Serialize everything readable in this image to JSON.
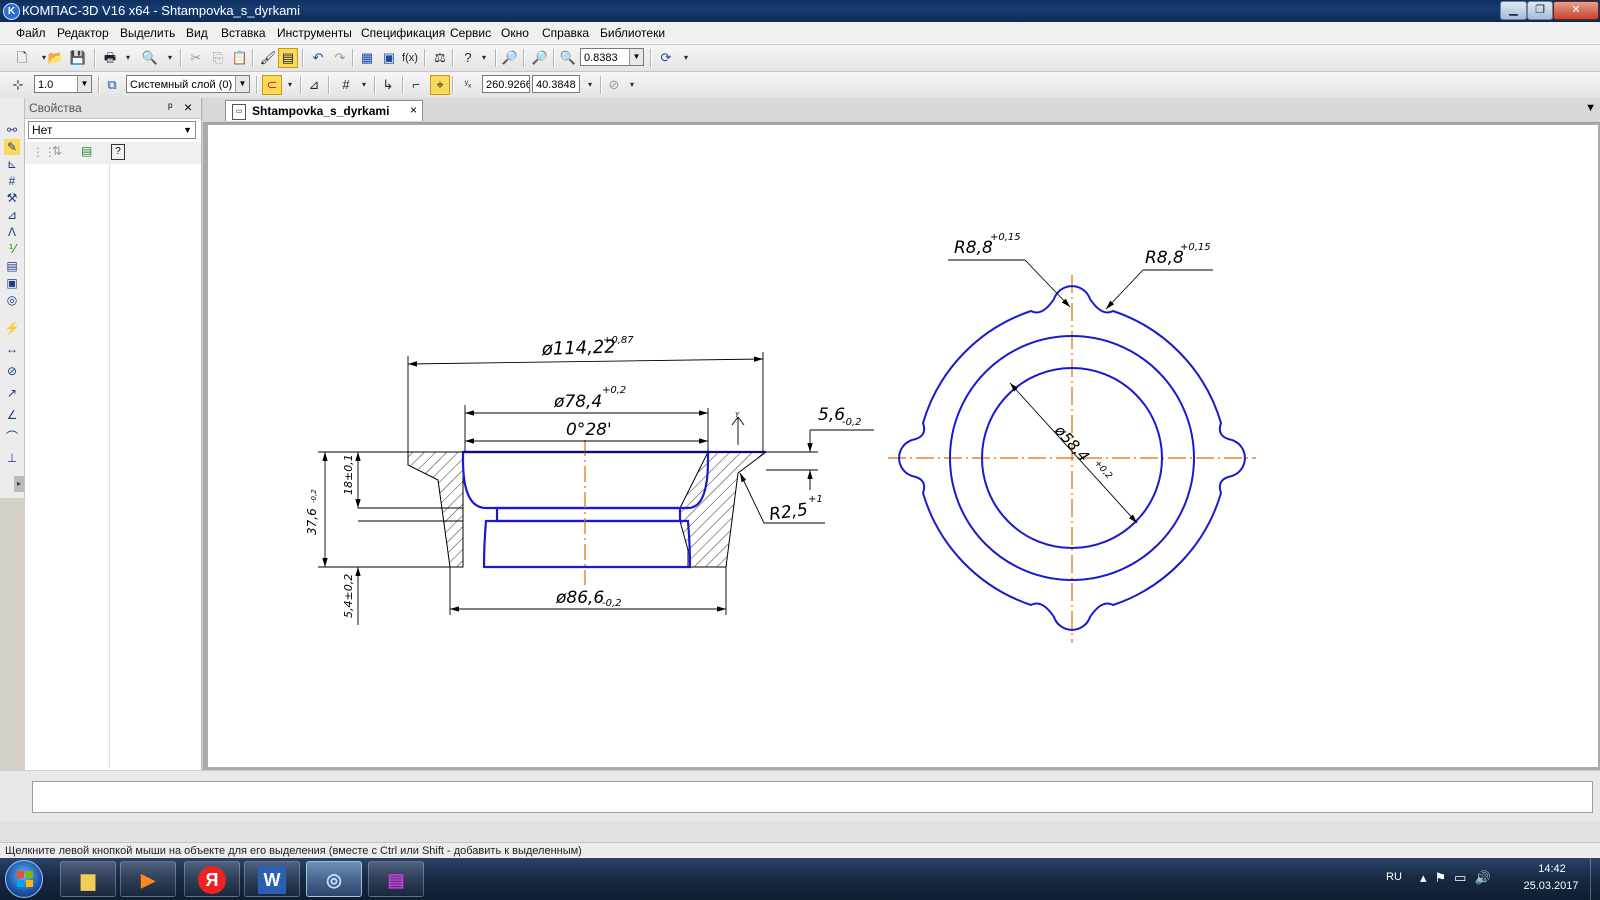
{
  "window": {
    "title": "КОМПАС-3D V16  x64 - Shtampovka_s_dyrkami",
    "app_icon": "K"
  },
  "menu": {
    "items": [
      "Файл",
      "Редактор",
      "Выделить",
      "Вид",
      "Вставка",
      "Инструменты",
      "Спецификация",
      "Сервис",
      "Окно",
      "Справка",
      "Библиотеки"
    ]
  },
  "toolbar1": {
    "zoom_value": "0.8383"
  },
  "toolbar2": {
    "line_scale": "1.0",
    "layer": "Системный слой (0)",
    "coord_x": "260.9266",
    "coord_y": "40.3848"
  },
  "properties": {
    "title": "Свойства",
    "pin": "ᵖ",
    "close": "×",
    "selection": "Нет"
  },
  "document": {
    "tab_label": "Shtampovka_s_dyrkami",
    "tab_close": "×"
  },
  "drawing": {
    "dims": {
      "d114": "ø114,22",
      "d114_tol": "+0,87",
      "d78": "ø78,4",
      "d78_tol": "+0,2",
      "angle": "0°28'",
      "d86": "ø86,6",
      "d86_tol": "-0,2",
      "h37": "37,6",
      "h37_tol": "-0,2",
      "h18": "18±0,1",
      "h54": "5,4±0,2",
      "t56": "5,6",
      "t56_tol": "-0,2",
      "r25": "R2,5",
      "r25_tol": "+1",
      "r88a": "R8,8",
      "r88a_tol": "+0,15",
      "r88b": "R8,8",
      "r88b_tol": "+0,15",
      "d58": "ø58,4",
      "d58_tol": "+0,2",
      "y_axis": "Y"
    },
    "colors": {
      "contour": "#1a1ad0",
      "axis": "#e07000",
      "thin": "#000000"
    }
  },
  "status": {
    "hint": "Щелкните левой кнопкой мыши на объекте для его выделения (вместе с Ctrl или Shift - добавить к выделенным)"
  },
  "taskbar": {
    "lang": "RU",
    "time": "14:42",
    "date": "25.03.2017",
    "yandex_label": "Я",
    "word_label": "W"
  }
}
